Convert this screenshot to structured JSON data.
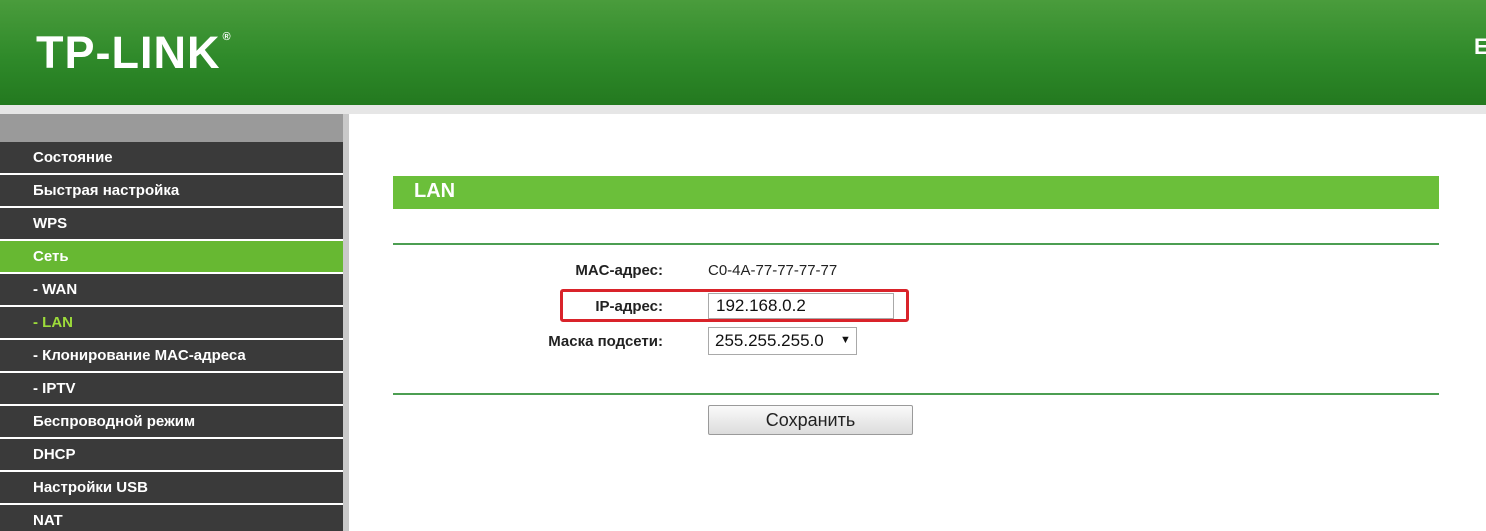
{
  "header": {
    "logo_text": "TP-LINK",
    "logo_mark": "®",
    "edge_text": "E"
  },
  "sidebar": {
    "items": [
      {
        "label": "Состояние"
      },
      {
        "label": "Быстрая настройка"
      },
      {
        "label": "WPS"
      },
      {
        "label": "Сеть"
      },
      {
        "label": "- WAN"
      },
      {
        "label": "- LAN"
      },
      {
        "label": "- Клонирование MAC-адреса"
      },
      {
        "label": "- IPTV"
      },
      {
        "label": "Беспроводной режим"
      },
      {
        "label": "DHCP"
      },
      {
        "label": "Настройки USB"
      },
      {
        "label": "NAT"
      }
    ]
  },
  "main": {
    "section_title": "LAN",
    "mac": {
      "label": "MAC-адрес:",
      "value": "C0-4A-77-77-77-77"
    },
    "ip": {
      "label": "IP-адрес:",
      "value": "192.168.0.2"
    },
    "mask": {
      "label": "Маска подсети:",
      "value": "255.255.255.0",
      "arrow": "▼"
    },
    "save_label": "Сохранить"
  },
  "colors": {
    "header_green": "#2f8a2a",
    "active_green": "#67b832",
    "current_text": "#9ddc3a",
    "highlight_red": "#d9232a",
    "nav_dark": "#3a3a3a"
  }
}
